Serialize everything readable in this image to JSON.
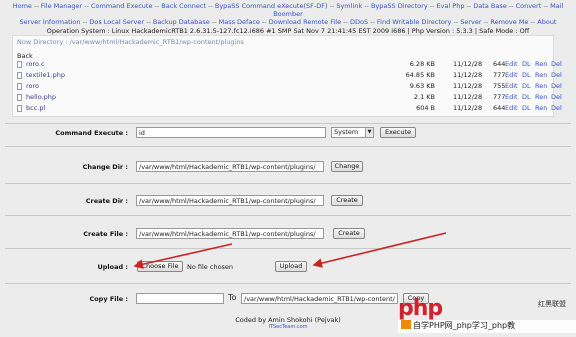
{
  "nav": {
    "line1": [
      "Home",
      "File Manager",
      "Command Execute",
      "Back Connect",
      "BypaSS Command eXecute(SF-DF)",
      "Symlink",
      "BypaSS Directory",
      "Eval Php",
      "Data Base",
      "Convert",
      "Mail Boomber"
    ],
    "line2": [
      "Server Information",
      "Dos Local Server",
      "Backup Database",
      "Mass Deface",
      "Download Remote File",
      "DDoS",
      "Find Writable Directory",
      "Server",
      "Remove Me",
      "About"
    ]
  },
  "sysinfo": "Operation System : Linux HackademicRTB1 2.6.31.5-127.fc12.i686 #1 SMP Sat Nov 7 21:41:45 EST 2009 i686 | Php Version : 5.3.3 | Safe Mode : Off",
  "file_panel": {
    "current_dir": "Now Directory : /var/www/html/Hackademic_RTB1/wp-content/plugins",
    "back_label": "Back",
    "actions": [
      "Edit",
      "DL",
      "Ren",
      "Del"
    ],
    "files": [
      {
        "name": "roro.c",
        "size": "6.28 KB",
        "date": "11/12/28",
        "perm": "644"
      },
      {
        "name": "textile1.php",
        "size": "64.85 KB",
        "date": "11/12/28",
        "perm": "777"
      },
      {
        "name": "roro",
        "size": "9.63 KB",
        "date": "11/12/28",
        "perm": "755"
      },
      {
        "name": "hello.php",
        "size": "2.1 KB",
        "date": "11/12/28",
        "perm": "777"
      },
      {
        "name": "bcc.pl",
        "size": "604 B",
        "date": "11/12/28",
        "perm": "644"
      }
    ]
  },
  "forms": {
    "command_execute": {
      "label": "Command Execute :",
      "value": "id",
      "select_value": "System",
      "button": "Execute"
    },
    "change_dir": {
      "label": "Change Dir :",
      "value": "/var/www/html/Hackademic_RTB1/wp-content/plugins/",
      "button": "Change"
    },
    "create_dir": {
      "label": "Create Dir :",
      "value": "/var/www/html/Hackademic_RTB1/wp-content/plugins/",
      "button": "Create"
    },
    "create_file": {
      "label": "Create File :",
      "value": "/var/www/html/Hackademic_RTB1/wp-content/plugins/",
      "button": "Create"
    },
    "upload": {
      "label": "Upload :",
      "choose_button": "Choose File",
      "no_file": "No file chosen",
      "button": "Upload"
    },
    "copy_file": {
      "label": "Copy File :",
      "from_value": "",
      "to_label": "To",
      "to_value": "/var/www/html/Hackademic_RTB1/wp-content/p",
      "button": "Copy"
    }
  },
  "footer": {
    "credit": "Coded by Amin Shokohi (Pejvak)",
    "site": "ITSecTeam.com"
  },
  "watermark": {
    "logo_text": "php",
    "brand_cn": "红黑联盟",
    "tagline": "自学PHP网_php学习_php教"
  },
  "colors": {
    "link": "#3355cc",
    "arrow": "#cc2222",
    "panel_bg": "#fafafa",
    "page_bg": "#ececec"
  }
}
